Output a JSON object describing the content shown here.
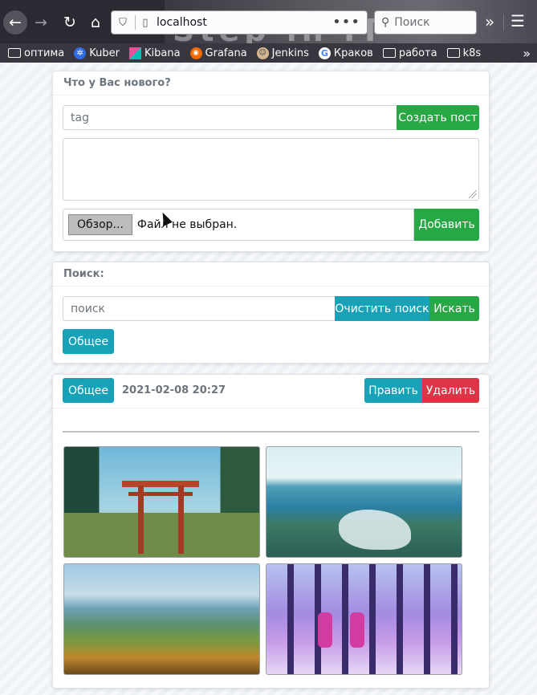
{
  "browser": {
    "url": "localhost",
    "search_placeholder": "Поиск",
    "banner_text": "Step in IT",
    "bookmarks": [
      {
        "label": "оптима",
        "icon": "folder-icon"
      },
      {
        "label": "Kuber",
        "icon": "kubernetes-icon"
      },
      {
        "label": "Kibana",
        "icon": "kibana-icon"
      },
      {
        "label": "Grafana",
        "icon": "grafana-icon"
      },
      {
        "label": "Jenkins",
        "icon": "jenkins-icon"
      },
      {
        "label": "Краков",
        "icon": "google-icon"
      },
      {
        "label": "работа",
        "icon": "folder-icon"
      },
      {
        "label": "k8s",
        "icon": "folder-icon"
      }
    ]
  },
  "new_post": {
    "header": "Что у Вас нового?",
    "tag_placeholder": "tag",
    "create_button": "Создать пост",
    "browse_button": "Обзор...",
    "no_file_text": "Файл не выбран.",
    "add_button": "Добавить"
  },
  "search": {
    "header": "Поиск:",
    "placeholder": "поиск",
    "clear_button": "Очистить поиск",
    "search_button": "Искать",
    "tag_button": "Общее"
  },
  "post": {
    "tag_button": "Общее",
    "date": "2021-02-08 20:27",
    "edit_button": "Править",
    "delete_button": "Удалить",
    "images": [
      "torii-gate-forest",
      "ocean-waves-rocks",
      "rice-terrace-valley",
      "purple-forest-deer"
    ]
  },
  "colors": {
    "green": "#28a745",
    "teal": "#17a2b8",
    "red": "#dc3545",
    "toolbar": "#2b2a33"
  }
}
